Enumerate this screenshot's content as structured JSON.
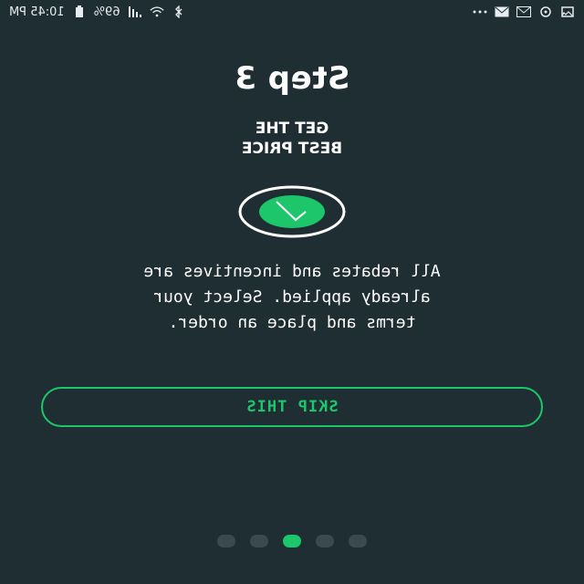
{
  "status_bar": {
    "time": "10:45 PM",
    "battery": "69%",
    "icons": [
      "battery-icon",
      "signal-icon",
      "wifi-icon",
      "bluetooth-icon",
      "more-icon",
      "mail-icon",
      "gmail-icon",
      "sync-icon",
      "image-icon"
    ]
  },
  "onboarding": {
    "step_title": "Step 3",
    "subtitle_line1": "GET THE",
    "subtitle_line2": "BEST PRICE",
    "description_line1": "All rebates and incentives are",
    "description_line2": "already applied. Select your",
    "description_line3": "terms and place an order.",
    "skip_label": "SKIP THIS",
    "pagination": {
      "total": 5,
      "active_index": 2
    }
  },
  "colors": {
    "background": "#1f2e33",
    "accent": "#1ec66b",
    "dot_inactive": "#3b4a4f",
    "text": "#ffffff"
  }
}
